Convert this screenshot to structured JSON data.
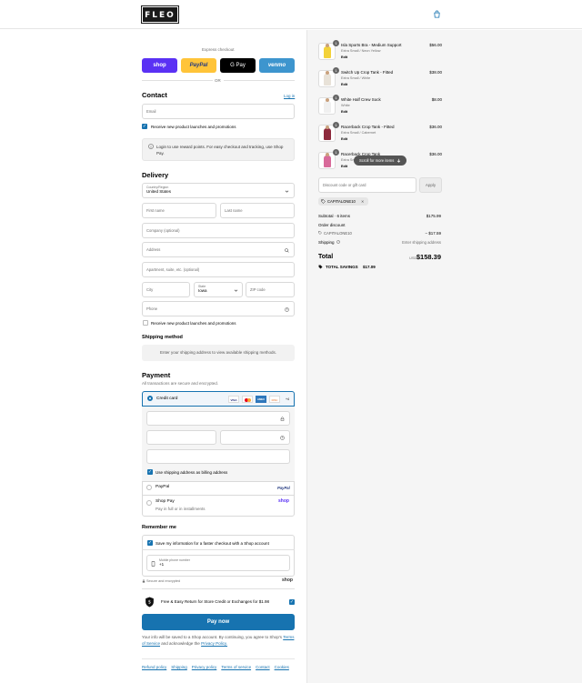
{
  "brand": {
    "logo": "FLEO"
  },
  "express": {
    "title": "Express checkout",
    "or": "OR",
    "shop": "shop",
    "paypal": "PayPal",
    "gpay": "G Pay",
    "venmo": "venmo"
  },
  "contact": {
    "heading": "Contact",
    "login": "Log in",
    "email_placeholder": "Email",
    "news_label": "Receive new product launches and promotions",
    "info": "Login to use reward points. For easy checkout and tracking, use Shop Pay."
  },
  "delivery": {
    "heading": "Delivery",
    "country_label": "Country/Region",
    "country_value": "United States",
    "first": "First name",
    "last": "Last name",
    "company": "Company (optional)",
    "address": "Address",
    "apt": "Apartment, suite, etc. (optional)",
    "city": "City",
    "state_label": "State",
    "state_value": "Iowa",
    "zip": "ZIP code",
    "phone": "Phone",
    "sms_label": "Receive new product launches and promotions"
  },
  "shipping": {
    "heading": "Shipping method",
    "note": "Enter your shipping address to view available shipping methods."
  },
  "payment": {
    "heading": "Payment",
    "sub": "All transactions are secure and encrypted.",
    "cc": "Credit card",
    "card_brands": [
      "VISA",
      "MC",
      "AMEX",
      "DISC",
      "+4"
    ],
    "billing_label": "Use shipping address as billing address",
    "paypal": "PayPal",
    "paypal_logo": "PayPal",
    "shoppay": "Shop Pay",
    "shoppay_sub": "Pay in full or in installments",
    "shoppay_logo": "shop"
  },
  "remember": {
    "heading": "Remember me",
    "save_label": "Save my information for a faster checkout with a Shop account",
    "mobile_label": "Mobile phone number",
    "mobile_value": "+1",
    "secure": "Secure and encrypted",
    "shop_logo": "shop"
  },
  "returns": {
    "label": "Free & Easy Return for Store Credit or Exchanges for $1.98"
  },
  "pay_button": "Pay now",
  "legal": {
    "line1": "Your info will be saved to a Shop account. By continuing, you agree to Shop's",
    "terms": "Terms of Service",
    "and": "and acknowledge the",
    "privacy": "Privacy Policy."
  },
  "footer": [
    "Refund policy",
    "Shipping",
    "Privacy policy",
    "Terms of service",
    "Contact",
    "Cookies"
  ],
  "cart": {
    "items": [
      {
        "qty": "1",
        "name": "Isla Sports Bra - Medium Support",
        "variant": "Extra Small / Neon Yellow",
        "tag": "Edit",
        "price": "$56.00",
        "color": "#f3d23a"
      },
      {
        "qty": "1",
        "name": "Switch Up Crop Tank - Fitted",
        "variant": "Extra Small / White",
        "tag": "Edit",
        "price": "$38.00",
        "color": "#e8e2d8"
      },
      {
        "qty": "1",
        "name": "White Half Crew Sock",
        "variant": "White",
        "tag": "Edit",
        "price": "$8.00",
        "color": "#f0f0f0"
      },
      {
        "qty": "1",
        "name": "Racerback Crop Tank - Fitted",
        "variant": "Extra Small / Cabernet",
        "tag": "Edit",
        "price": "$36.00",
        "color": "#8e2a3d"
      },
      {
        "qty": "1",
        "name": "Racerback Crop Tank",
        "variant": "Extra Small",
        "tag": "Edit",
        "price": "$36.00",
        "color": "#d86a9a"
      }
    ],
    "scroll_hint": "Scroll for more items",
    "discount_placeholder": "Discount code or gift card",
    "apply": "Apply",
    "code": "CAPITALONE10",
    "subtotal_label": "Subtotal · 6 items",
    "subtotal": "$175.99",
    "order_discount": "Order discount",
    "discount_code": "CAPITALONE10",
    "discount_amount": "− $17.59",
    "shipping_label": "Shipping",
    "shipping_value": "Enter shipping address",
    "total_label": "Total",
    "currency": "USD",
    "total": "$158.39",
    "savings_label": "TOTAL SAVINGS",
    "savings": "$17.09"
  },
  "colors": {
    "accent": "#1773b0",
    "shop": "#5a31f4",
    "paypal": "#ffc439",
    "venmo": "#3d95ce"
  }
}
